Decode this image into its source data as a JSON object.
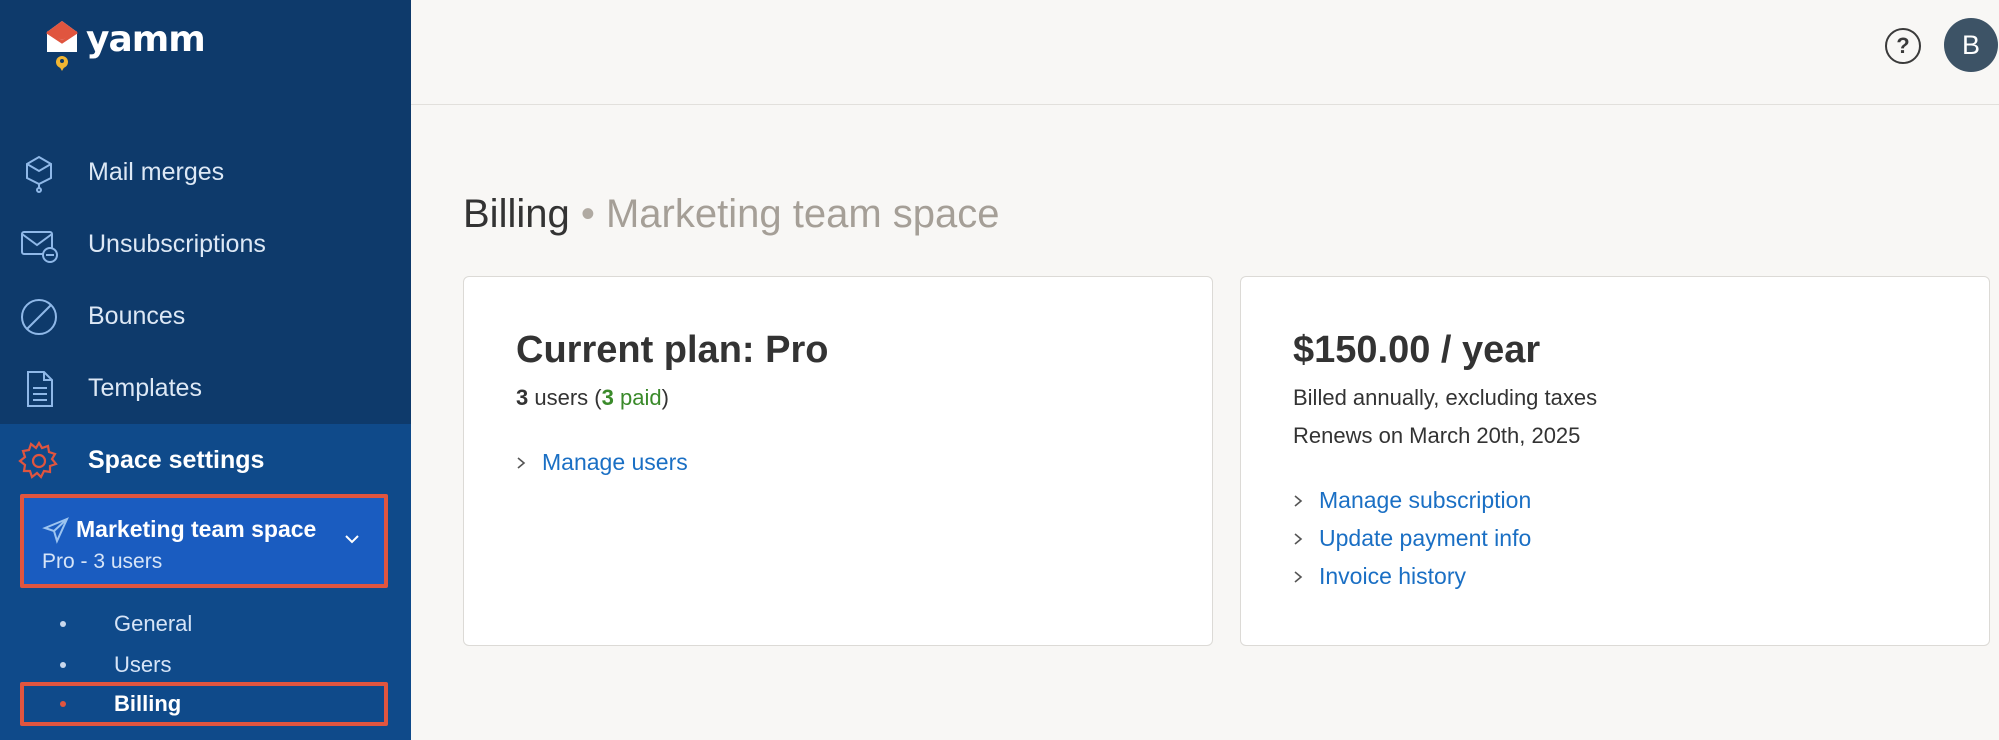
{
  "app": {
    "logo_text": "yamm",
    "colors": {
      "sidebar": "#0e3a6b",
      "sidebar_active": "#0f4a8a",
      "accent_orange": "#e0553f",
      "link_blue": "#1a6fc4",
      "paid_green": "#3a8a2a"
    }
  },
  "sidebar": {
    "items": [
      {
        "label": "Mail merges",
        "icon": "mail-merge-icon"
      },
      {
        "label": "Unsubscriptions",
        "icon": "unsubscribe-icon"
      },
      {
        "label": "Bounces",
        "icon": "bounce-icon"
      },
      {
        "label": "Templates",
        "icon": "template-icon"
      },
      {
        "label": "Space settings",
        "icon": "gear-icon"
      }
    ],
    "space": {
      "name": "Marketing team space",
      "plan": "Pro - 3 users"
    },
    "subitems": [
      {
        "label": "General"
      },
      {
        "label": "Users"
      },
      {
        "label": "Billing"
      }
    ]
  },
  "header": {
    "help_label": "?",
    "avatar_initial": "B"
  },
  "main": {
    "title": "Billing",
    "separator": "•",
    "subtitle": "Marketing team space",
    "plan_card": {
      "heading": "Current plan: Pro",
      "users_count": "3",
      "users_text": "users (",
      "paid_count": "3",
      "paid_text": "paid",
      "close_paren": ")",
      "links": [
        {
          "label": "Manage users"
        }
      ]
    },
    "price_card": {
      "heading": "$150.00 / year",
      "billed_text": "Billed annually, excluding taxes",
      "renew_text": "Renews on March 20th, 2025",
      "links": [
        {
          "label": "Manage subscription"
        },
        {
          "label": "Update payment info"
        },
        {
          "label": "Invoice history"
        }
      ]
    }
  }
}
